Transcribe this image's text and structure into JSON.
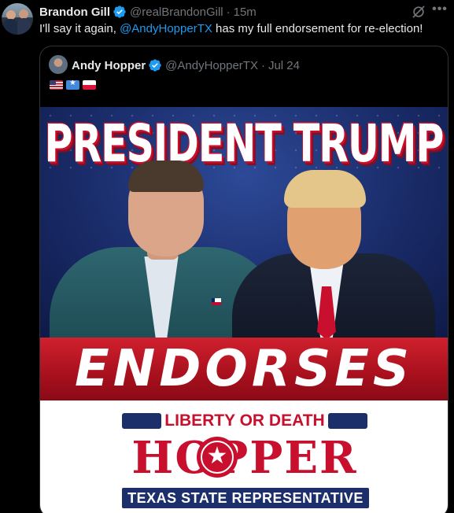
{
  "post": {
    "author_name": "Brandon Gill",
    "author_handle": "@realBrandonGill",
    "separator": "·",
    "time": "15m",
    "text_before": "I'll say it again, ",
    "mention": "@AndyHopperTX",
    "text_after": " has my full endorsement for re-election!",
    "icons": [
      "verified-badge-icon",
      "grok-icon",
      "more-icon"
    ]
  },
  "quote": {
    "author_name": "Andy Hopper",
    "author_handle": "@AndyHopperTX",
    "separator": "·",
    "date": "Jul 24",
    "flags": [
      "us-flag-icon",
      "somalia-flag-icon",
      "poland-flag-icon"
    ]
  },
  "graphic": {
    "headline": "PRESIDENT TRUMP",
    "banner": "ENDORSES",
    "logo_top": "LIBERTY OR DEATH",
    "logo_name": "HOPPER",
    "logo_bottom": "TEXAS STATE REPRESENTATIVE"
  },
  "colors": {
    "background": "#000000",
    "text": "#e7e9ea",
    "muted": "#71767b",
    "link": "#1d9bf0",
    "verified": "#1d9bf0",
    "graphic_red": "#c8102e",
    "graphic_navy": "#1c2f6b"
  }
}
